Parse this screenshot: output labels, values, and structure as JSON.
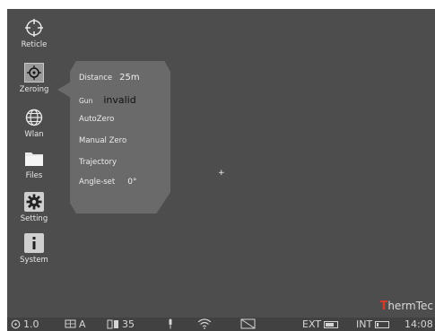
{
  "menu": {
    "items": [
      {
        "label": "Reticle",
        "icon": "crosshair-circle-icon"
      },
      {
        "label": "Zeroing",
        "icon": "target-icon"
      },
      {
        "label": "Wlan",
        "icon": "globe-icon"
      },
      {
        "label": "Files",
        "icon": "folder-icon"
      },
      {
        "label": "Setting",
        "icon": "gear-icon"
      },
      {
        "label": "System",
        "icon": "info-icon"
      }
    ]
  },
  "popup": {
    "distance_label": "Distance",
    "distance_value": "25m",
    "gun_label": "Gun",
    "gun_value": "invalid",
    "autozero_label": "AutoZero",
    "manual_zero_label": "Manual Zero",
    "trajectory_label": "Trajectory",
    "angle_label": "Angle-set",
    "angle_value": "0°"
  },
  "crosshair": "+",
  "logo": {
    "first": "T",
    "rest": "hermTec"
  },
  "statusbar": {
    "zoom": "1.0",
    "palette_mode": "A",
    "brightness": "35",
    "ext_label": "EXT",
    "int_label": "INT",
    "ext_battery_level": 0.8,
    "int_battery_level": 0.25,
    "time": "14:08"
  },
  "colors": {
    "screen_bg": "#4d4d4d",
    "popup_bg": "#6a6a6a",
    "logo_accent": "#d43b2b"
  }
}
